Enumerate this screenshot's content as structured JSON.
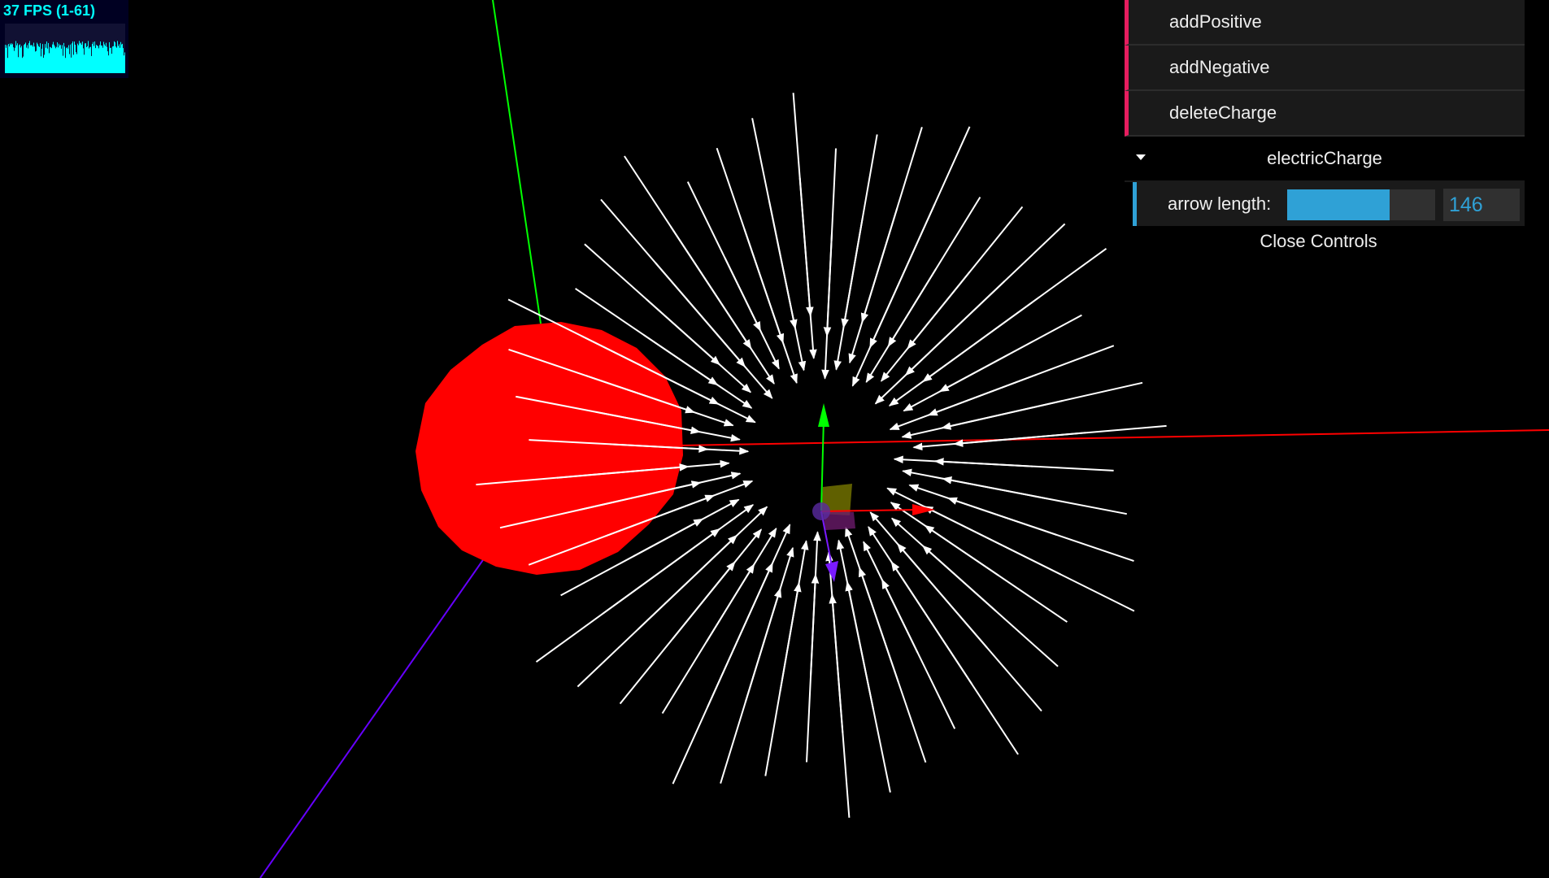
{
  "fps": {
    "label": "37 FPS (1-61)",
    "text_color": "#00ffff",
    "background": "#000022"
  },
  "gui": {
    "buttons": [
      {
        "label": "addPositive"
      },
      {
        "label": "addNegative"
      },
      {
        "label": "deleteCharge"
      }
    ],
    "folder": {
      "title": "electricCharge",
      "slider": {
        "label": "arrow length:",
        "value": "146",
        "fill_fraction": 0.69
      }
    },
    "close_label": "Close Controls",
    "accent_function": "#e61d5f",
    "accent_number": "#2fa1d6"
  },
  "scene": {
    "background": "#000000",
    "charge_sphere_color": "#ff0000",
    "field_arrow_color": "#ffffff",
    "axes": {
      "x_color": "#ff0000",
      "y_color": "#00ff00",
      "z_color": "#6600ff"
    }
  }
}
